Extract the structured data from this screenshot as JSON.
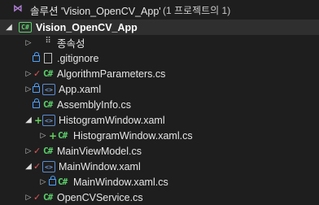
{
  "solution": {
    "name": "솔루션 'Vision_OpenCV_App'",
    "project_count": "(1 프로젝트의 1)"
  },
  "project": {
    "name": "Vision_OpenCV_App",
    "badge": "C#"
  },
  "items": [
    {
      "label": "종속성",
      "icon": "references-icon"
    },
    {
      "label": ".gitignore",
      "icon": "file-icon"
    },
    {
      "label": "AlgorithmParameters.cs",
      "icon": "csharp-icon"
    },
    {
      "label": "App.xaml",
      "icon": "xaml-icon"
    },
    {
      "label": "AssemblyInfo.cs",
      "icon": "csharp-icon"
    },
    {
      "label": "HistogramWindow.xaml",
      "icon": "xaml-icon"
    },
    {
      "label": "HistogramWindow.xaml.cs",
      "icon": "csharp-icon"
    },
    {
      "label": "MainViewModel.cs",
      "icon": "csharp-icon"
    },
    {
      "label": "MainWindow.xaml",
      "icon": "xaml-icon"
    },
    {
      "label": "MainWindow.xaml.cs",
      "icon": "csharp-icon"
    },
    {
      "label": "OpenCVService.cs",
      "icon": "csharp-icon"
    }
  ],
  "glyphs": {
    "collapsed": "▷",
    "expanded": "◢",
    "modified": "✓",
    "added": "+",
    "csharp": "C#",
    "xaml": "<>",
    "vs": "⋈",
    "refs": "⠿"
  },
  "colors": {
    "background": "#1e1e1e",
    "selected_row": "#2f2f2f",
    "lock": "#4da3ff",
    "modified": "#e05555",
    "added": "#66d15c",
    "csharp": "#5bd16b"
  }
}
